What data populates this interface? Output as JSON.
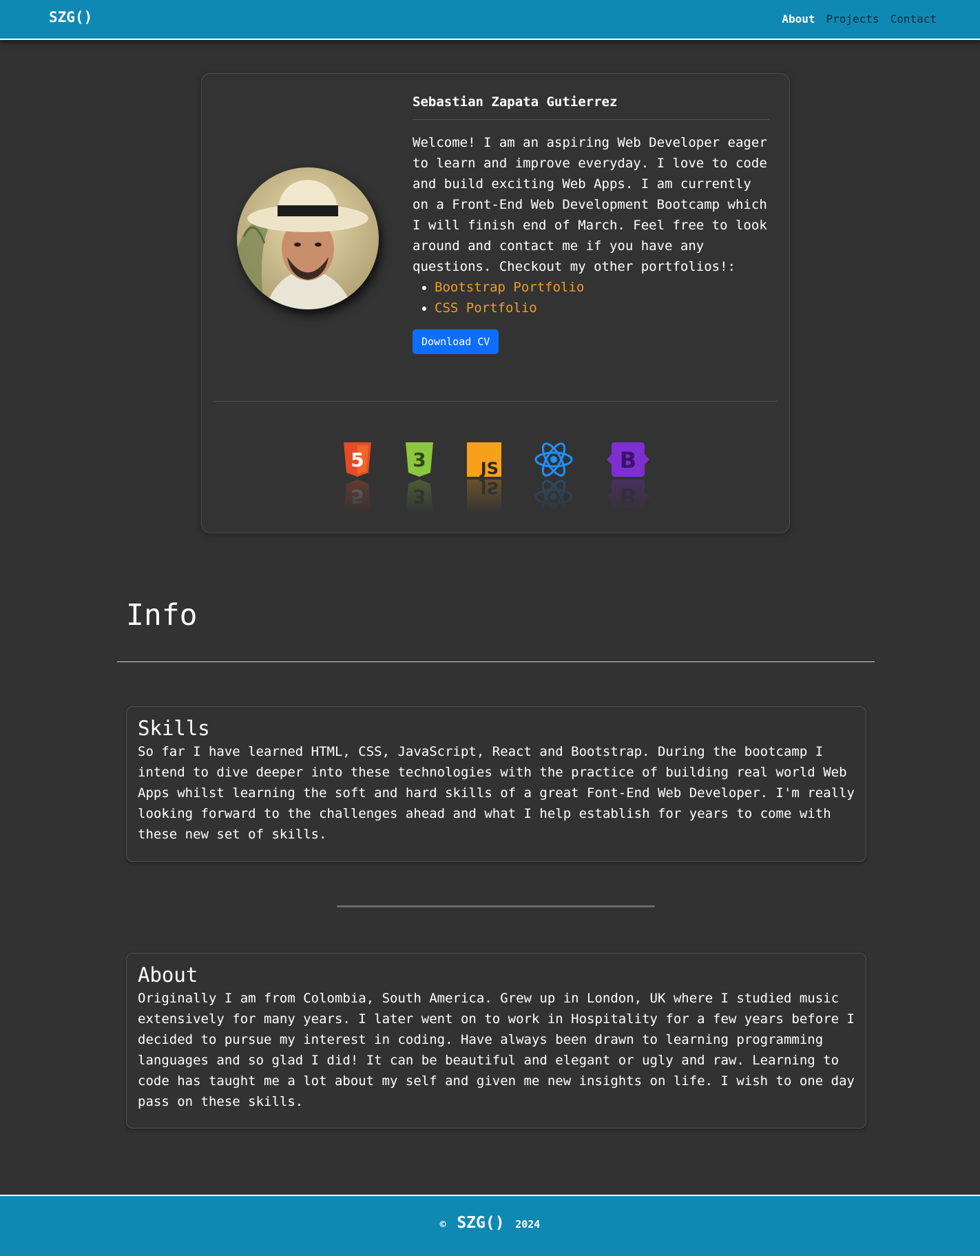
{
  "nav": {
    "brand": "SZG()",
    "links": [
      {
        "label": "About",
        "active": true
      },
      {
        "label": "Projects",
        "active": false
      },
      {
        "label": "Contact",
        "active": false
      }
    ]
  },
  "profile": {
    "name": "Sebastian Zapata Gutierrez",
    "bio": "Welcome! I am an aspiring Web Developer eager to learn and improve everyday. I love to code and build exciting Web Apps. I am currently on a Front-End Web Development Bootcamp which I will finish end of March. Feel free to look around and contact me if you have any questions. Checkout my other portfolios!:",
    "portfolios": [
      "Bootstrap Portfolio",
      "CSS Portfolio"
    ],
    "cv_button": "Download CV"
  },
  "tech_icons": [
    {
      "name": "html5-icon",
      "label": "5",
      "color": "#e34c26"
    },
    {
      "name": "css3-icon",
      "label": "3",
      "color": "#8dc63f"
    },
    {
      "name": "javascript-icon",
      "label": "JS",
      "color": "#f7a11a"
    },
    {
      "name": "react-icon",
      "color": "#1e90ff"
    },
    {
      "name": "bootstrap-icon",
      "label": "B",
      "color": "#7e2fd4"
    }
  ],
  "info": {
    "title": "Info",
    "skills": {
      "title": "Skills",
      "text": "So far I have learned HTML, CSS, JavaScript, React and Bootstrap. During the bootcamp I intend to dive deeper into these technologies with the practice of building real world Web Apps whilst learning the soft and hard skills of a great Font-End Web Developer. I'm really looking forward to the challenges ahead and what I help establish for years to come with these new set of skills."
    },
    "about": {
      "title": "About",
      "text": "Originally I am from Colombia, South America. Grew up in London, UK where I studied music extensively for many years. I later went on to work in Hospitality for a few years before I decided to pursue my interest in coding. Have always been drawn to learning programming languages and so glad I did! It can be beautiful and elegant or ugly and raw. Learning to code has taught me a lot about my self and given me new insights on life. I wish to one day pass on these skills."
    }
  },
  "footer": {
    "copyright": "©",
    "brand": "SZG()",
    "year": "2024"
  }
}
